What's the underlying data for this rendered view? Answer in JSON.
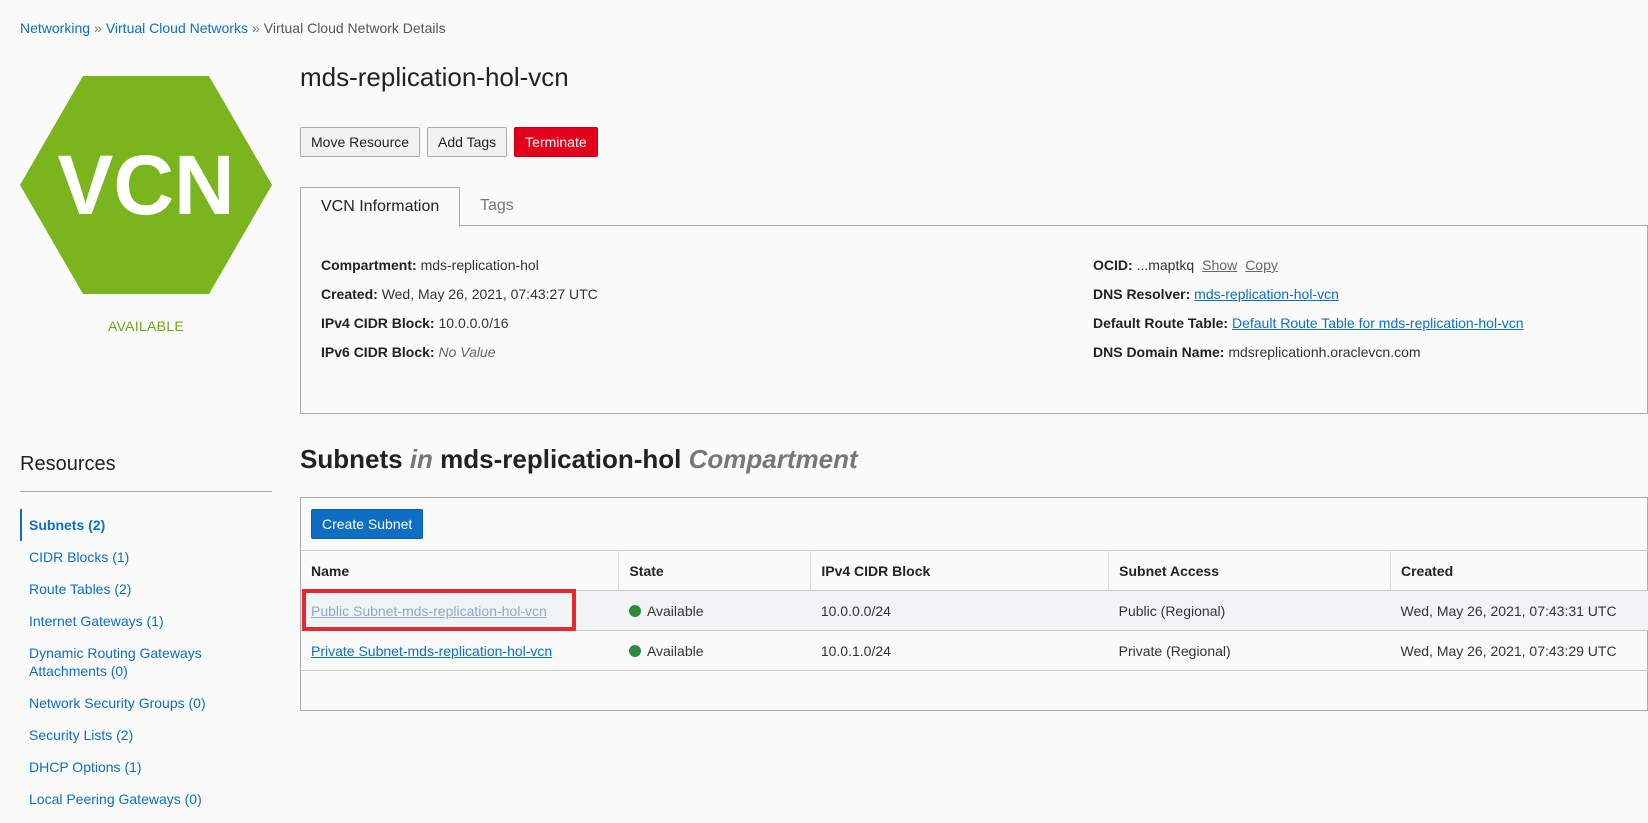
{
  "breadcrumb": {
    "items": [
      "Networking",
      "Virtual Cloud Networks"
    ],
    "current": "Virtual Cloud Network Details",
    "separator": "»"
  },
  "logo": {
    "text": "VCN",
    "status": "AVAILABLE",
    "color": "#7ab51d"
  },
  "page_title": "mds-replication-hol-vcn",
  "actions": {
    "move": "Move Resource",
    "add_tags": "Add Tags",
    "terminate": "Terminate"
  },
  "tabs": [
    {
      "label": "VCN Information",
      "active": true
    },
    {
      "label": "Tags",
      "active": false
    }
  ],
  "info": {
    "left": [
      {
        "label": "Compartment:",
        "value": "mds-replication-hol"
      },
      {
        "label": "Created:",
        "value": "Wed, May 26, 2021, 07:43:27 UTC"
      },
      {
        "label": "IPv4 CIDR Block:",
        "value": "10.0.0.0/16"
      },
      {
        "label": "IPv6 CIDR Block:",
        "value": "No Value"
      }
    ],
    "ocid": {
      "label": "OCID:",
      "value": "...maptkq",
      "show": "Show",
      "copy": "Copy"
    },
    "dns_resolver": {
      "label": "DNS Resolver:",
      "value": "mds-replication-hol-vcn"
    },
    "route_table": {
      "label": "Default Route Table:",
      "value": "Default Route Table for mds-replication-hol-vcn"
    },
    "dns_domain": {
      "label": "DNS Domain Name:",
      "value": "mdsreplicationh.oraclevcn.com"
    }
  },
  "resources": {
    "title": "Resources",
    "items": [
      {
        "label": "Subnets (2)",
        "active": true
      },
      {
        "label": "CIDR Blocks (1)"
      },
      {
        "label": "Route Tables (2)"
      },
      {
        "label": "Internet Gateways (1)"
      },
      {
        "label": "Dynamic Routing Gateways Attachments (0)"
      },
      {
        "label": "Network Security Groups (0)"
      },
      {
        "label": "Security Lists (2)"
      },
      {
        "label": "DHCP Options (1)"
      },
      {
        "label": "Local Peering Gateways (0)"
      }
    ]
  },
  "subnets": {
    "title": "Subnets",
    "in": "in",
    "compartment": "mds-replication-hol",
    "compartment_word": "Compartment",
    "create_button": "Create Subnet",
    "columns": [
      "Name",
      "State",
      "IPv4 CIDR Block",
      "Subnet Access",
      "Created"
    ],
    "rows": [
      {
        "name": "Public Subnet-mds-replication-hol-vcn",
        "state": "Available",
        "cidr": "10.0.0.0/24",
        "access": "Public (Regional)",
        "created": "Wed, May 26, 2021, 07:43:31 UTC"
      },
      {
        "name": "Private Subnet-mds-replication-hol-vcn",
        "state": "Available",
        "cidr": "10.0.1.0/24",
        "access": "Private (Regional)",
        "created": "Wed, May 26, 2021, 07:43:29 UTC"
      }
    ],
    "status_color": "#2f8a3a",
    "highlight_color": "#e8282e"
  }
}
